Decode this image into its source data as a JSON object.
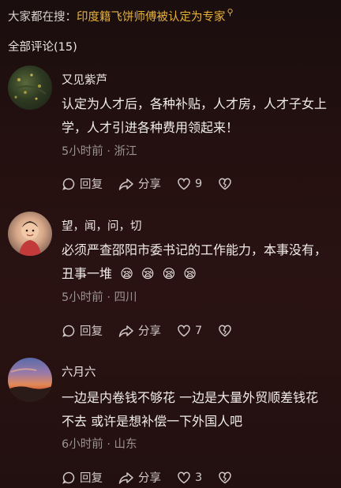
{
  "search_hint": {
    "prefix": "大家都在搜：",
    "query": "印度籍飞饼师傅被认定为专家",
    "icon": "search-icon"
  },
  "comment_count_label": "全部评论(15)",
  "comments": [
    {
      "username": "又见紫芦",
      "text": "认定为人才后，各种补贴，人才房，人才子女上学，人才引进各种费用领起来！",
      "meta": "5小时前 · 浙江",
      "reply_label": "回复",
      "share_label": "分享",
      "like_count": "9"
    },
    {
      "username": "望，闻，问，切",
      "text": "必须严查邵阳市委书记的工作能力，本事没有，丑事一堆",
      "emojis": [
        "😪",
        "😪",
        "😪",
        "😪"
      ],
      "meta": "5小时前 · 四川",
      "reply_label": "回复",
      "share_label": "分享",
      "like_count": "7"
    },
    {
      "username": "六月六",
      "text": "一边是内卷钱不够花 一边是大量外贸顺差钱花不去  或许是想补偿一下外国人吧",
      "meta": "6小时前 · 山东",
      "reply_label": "回复",
      "share_label": "分享",
      "like_count": "3"
    }
  ],
  "colors": {
    "accent": "#e7b23a",
    "meta_text": "#9a9290"
  }
}
